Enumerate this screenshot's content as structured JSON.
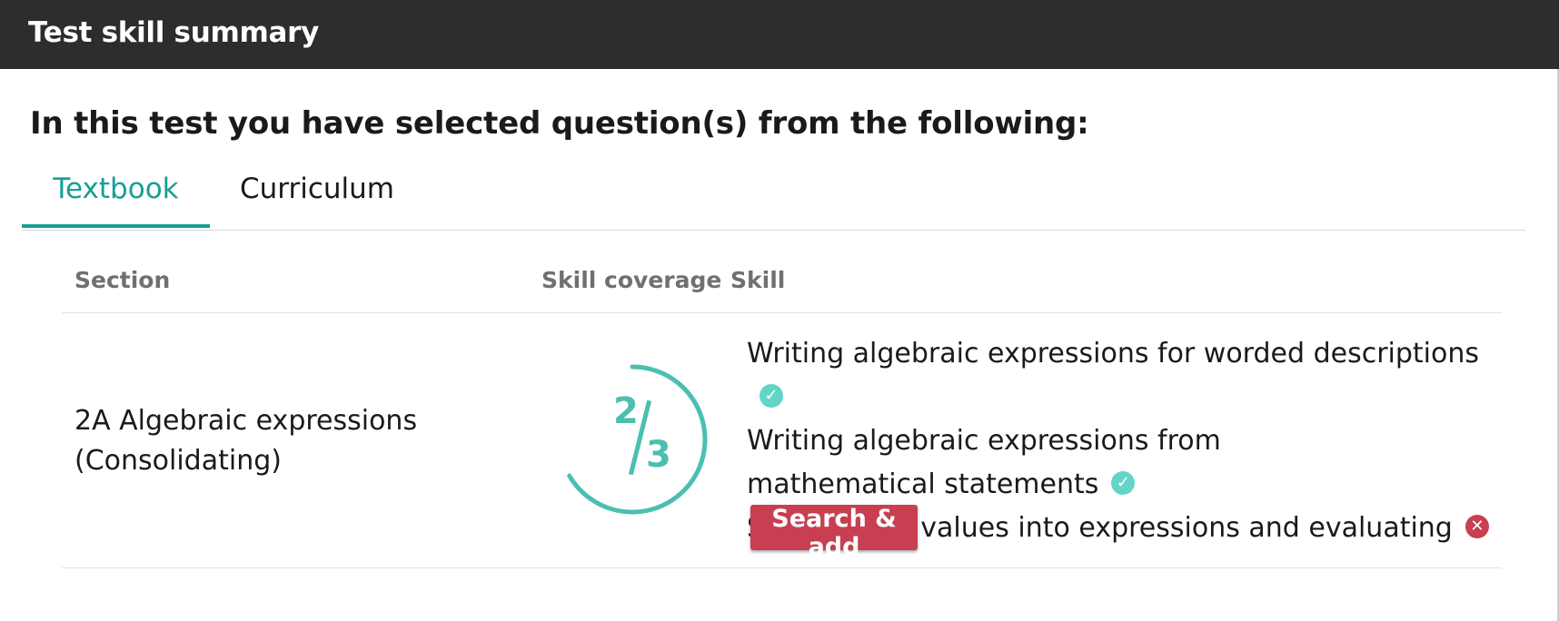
{
  "header": {
    "title": "Test skill summary"
  },
  "intro": "In this test you have selected question(s) from the following:",
  "tabs": [
    {
      "label": "Textbook",
      "active": true
    },
    {
      "label": "Curriculum",
      "active": false
    }
  ],
  "table": {
    "columns": {
      "section": "Section",
      "coverage": "Skill coverage",
      "skill": "Skill"
    },
    "rows": [
      {
        "section": "2A Algebraic expressions (Consolidating)",
        "coverage": {
          "numerator": "2",
          "denominator": "3",
          "fraction": 0.6667
        },
        "skills": [
          {
            "text": "Writing algebraic expressions for worded descriptions",
            "status": "covered",
            "icon": "check-circle-icon"
          },
          {
            "text": "Writing algebraic expressions from mathematical statements",
            "status": "covered",
            "icon": "check-circle-icon"
          },
          {
            "text": "Substituting values into expressions and evaluating",
            "status": "missing",
            "icon": "x-circle-icon"
          }
        ],
        "action": "Search & add"
      }
    ]
  },
  "colors": {
    "accent": "#179e96",
    "coverage": "#4bbfb0",
    "check": "#62d4c8",
    "error": "#c73f50",
    "header": "#2d2d2d"
  }
}
